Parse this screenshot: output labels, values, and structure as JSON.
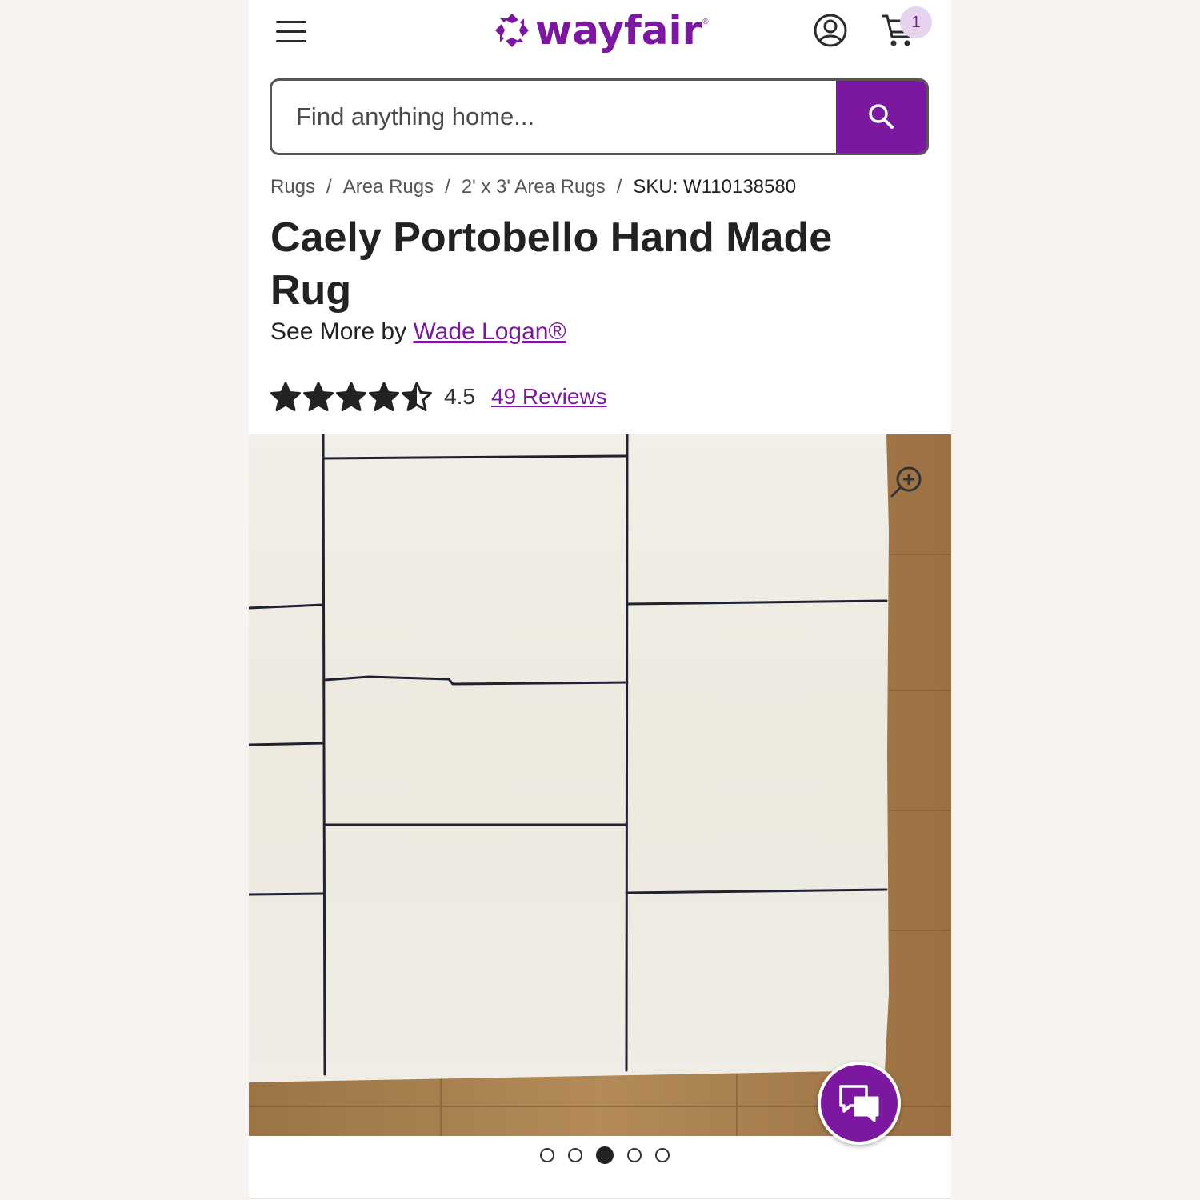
{
  "header": {
    "logo_text": "wayfair",
    "cart_count": "1"
  },
  "search": {
    "placeholder": "Find anything home..."
  },
  "breadcrumb": {
    "items": [
      "Rugs",
      "Area Rugs",
      "2' x 3' Area Rugs"
    ],
    "separator": "/",
    "sku": "SKU: W110138580"
  },
  "product": {
    "title": "Caely Portobello Hand Made Rug",
    "see_more_prefix": "See More by",
    "brand": "Wade Logan®",
    "rating": "4.5",
    "rating_value": 4.5,
    "rating_max": 5,
    "reviews_label": "49 Reviews"
  },
  "carousel": {
    "total": 5,
    "active_index": 2
  },
  "colors": {
    "brand": "#7b189f",
    "badge_bg": "#e6d4ef",
    "rug": "#efece3",
    "floor": "#a57a4c"
  }
}
